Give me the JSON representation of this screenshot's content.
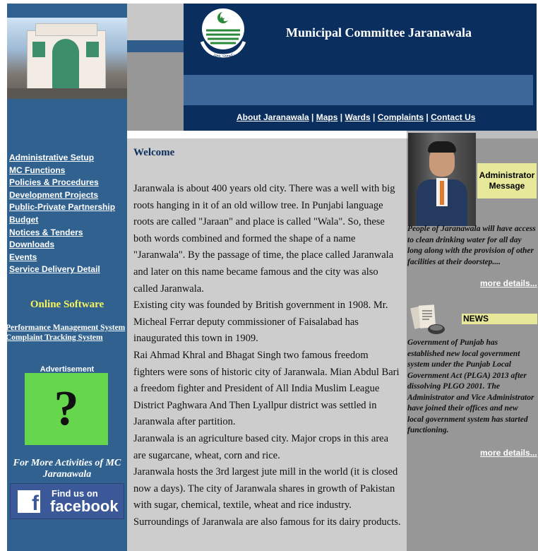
{
  "header": {
    "title": "Municipal Committee Jaranawala",
    "logo_caption": "حکومت پنجاب",
    "nav": [
      {
        "label": "About Jaranawala"
      },
      {
        "label": "Maps"
      },
      {
        "label": "Wards"
      },
      {
        "label": "Complaints"
      },
      {
        "label": "Contact Us"
      }
    ]
  },
  "sidebar": {
    "menu": [
      {
        "label": "Administrative Setup"
      },
      {
        "label": "MC Functions"
      },
      {
        "label": "Policies & Procedures"
      },
      {
        "label": "Development Projects"
      },
      {
        "label": "Public-Private Partnership"
      },
      {
        "label": "Budget"
      },
      {
        "label": "Notices & Tenders"
      },
      {
        "label": "Downloads"
      },
      {
        "label": "Events"
      },
      {
        "label": "Service Delivery Detail"
      }
    ],
    "online_software_heading": "Online Software",
    "software_links": [
      {
        "label": "Performance Management System"
      },
      {
        "label": "Complaint Tracking System"
      }
    ],
    "advertisement_label": "Advertisement",
    "advertisement_glyph": "?",
    "more_activities": "For More Activities of MC Jaranawala",
    "facebook": {
      "find_us": "Find us on",
      "brand": "facebook",
      "letter": "f"
    }
  },
  "main": {
    "heading": "Welcome",
    "paragraphs": [
      "Jaranwala is about 400 years old city. There was a well with big roots hanging in it of an old willow tree. In Punjabi language roots are called \"Jaraan\" and place is called \"Wala\". So, these both words combined and formed the shape of a name \"Jaranwala\". By the passage of time, the place called Jaranwala and later on this name became famous and the city was also called Jaranwala.",
      "Existing city was founded by British government in 1908. Mr. Micheal Ferrar deputy commissioner of Faisalabad has inaugurated this town in 1909.",
      "Rai Ahmad Khral and Bhagat Singh two famous freedom fighters were sons of historic city of Jaranwala. Mian Abdul Bari a freedom fighter and President of All India Muslim League District Paghwara And Then Lyallpur district was settled in Jaranwala after partition.",
      "Jaranwala is an agriculture based city. Major crops in this area are sugarcane, wheat, corn and rice.",
      "Jaranwala hosts the 3rd largest jute mill in the world (it is closed now a days). The city of Jaranwala shares in growth of Pakistan with sugar, chemical, textile, wheat and rice industry. Surroundings of Jaranwala are also famous for its dairy products."
    ]
  },
  "right": {
    "admin_label": "Administrator Message",
    "admin_message": "People of Jaranawala will have access to clean drinking water for all day long along with the provision of other facilities at their doorstep....",
    "admin_more": "more details...",
    "news_label": "NEWS",
    "news_lines": [
      "Government of Punjab has established new local government system under the Punjab Local Government Act (PLGA) 2013 after dissolving PLGO 2001. The Administrator and Vice Administrator",
      "have joined their offices and new local government system has started functioning."
    ],
    "news_more": "more details..."
  }
}
